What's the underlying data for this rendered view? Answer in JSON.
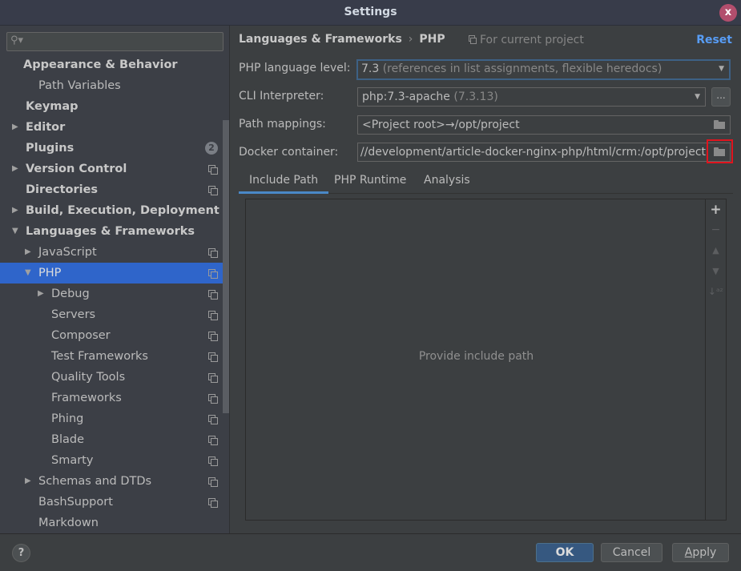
{
  "window": {
    "title": "Settings",
    "close_label": "x"
  },
  "sidebar": {
    "search_placeholder": "",
    "items": [
      {
        "label": "Appearance & Behavior",
        "bold": true,
        "level": 0,
        "arrow": "",
        "icon": ""
      },
      {
        "label": "Path Variables",
        "bold": false,
        "level": 1,
        "arrow": "",
        "icon": ""
      },
      {
        "label": "Keymap",
        "bold": true,
        "level": 0,
        "arrow": "",
        "icon": ""
      },
      {
        "label": "Editor",
        "bold": true,
        "level": 0,
        "arrow": "collapsed",
        "icon": ""
      },
      {
        "label": "Plugins",
        "bold": true,
        "level": 0,
        "arrow": "",
        "icon": "",
        "badge": "2"
      },
      {
        "label": "Version Control",
        "bold": true,
        "level": 0,
        "arrow": "collapsed",
        "icon": "project"
      },
      {
        "label": "Directories",
        "bold": true,
        "level": 0,
        "arrow": "",
        "icon": "project"
      },
      {
        "label": "Build, Execution, Deployment",
        "bold": true,
        "level": 0,
        "arrow": "collapsed",
        "icon": ""
      },
      {
        "label": "Languages & Frameworks",
        "bold": true,
        "level": 0,
        "arrow": "expanded",
        "icon": ""
      },
      {
        "label": "JavaScript",
        "bold": false,
        "level": 1,
        "arrow": "collapsed",
        "icon": "project"
      },
      {
        "label": "PHP",
        "bold": false,
        "level": 1,
        "arrow": "expanded",
        "icon": "project",
        "selected": true
      },
      {
        "label": "Debug",
        "bold": false,
        "level": 2,
        "arrow": "collapsed",
        "icon": "project"
      },
      {
        "label": "Servers",
        "bold": false,
        "level": 2,
        "arrow": "",
        "icon": "project"
      },
      {
        "label": "Composer",
        "bold": false,
        "level": 2,
        "arrow": "",
        "icon": "project"
      },
      {
        "label": "Test Frameworks",
        "bold": false,
        "level": 2,
        "arrow": "",
        "icon": "project"
      },
      {
        "label": "Quality Tools",
        "bold": false,
        "level": 2,
        "arrow": "",
        "icon": "project"
      },
      {
        "label": "Frameworks",
        "bold": false,
        "level": 2,
        "arrow": "",
        "icon": "project"
      },
      {
        "label": "Phing",
        "bold": false,
        "level": 2,
        "arrow": "",
        "icon": "project"
      },
      {
        "label": "Blade",
        "bold": false,
        "level": 2,
        "arrow": "",
        "icon": "project"
      },
      {
        "label": "Smarty",
        "bold": false,
        "level": 2,
        "arrow": "",
        "icon": "project"
      },
      {
        "label": "Schemas and DTDs",
        "bold": false,
        "level": 1,
        "arrow": "collapsed",
        "icon": "project"
      },
      {
        "label": "BashSupport",
        "bold": false,
        "level": 1,
        "arrow": "",
        "icon": "project"
      },
      {
        "label": "Markdown",
        "bold": false,
        "level": 1,
        "arrow": "",
        "icon": ""
      }
    ]
  },
  "header": {
    "breadcrumb": [
      "Languages & Frameworks",
      "PHP"
    ],
    "breadcrumb_sep": "›",
    "scope": "For current project",
    "reset": "Reset"
  },
  "form": {
    "language_level": {
      "label": "PHP language level:",
      "value": "7.3",
      "hint": "(references in list assignments, flexible heredocs)"
    },
    "cli_interpreter": {
      "label": "CLI Interpreter:",
      "value": "php:7.3-apache",
      "hint": "(7.3.13)",
      "more_button": "..."
    },
    "path_mappings": {
      "label": "Path mappings:",
      "value": "<Project root>→/opt/project"
    },
    "docker_container": {
      "label": "Docker container:",
      "value": "//development/article-docker-nginx-php/html/crm:/opt/project"
    }
  },
  "tabs": [
    {
      "label": "Include Path",
      "active": true
    },
    {
      "label": "PHP Runtime",
      "active": false
    },
    {
      "label": "Analysis",
      "active": false
    }
  ],
  "include_path": {
    "empty_text": "Provide include path",
    "tools": {
      "add": "+",
      "remove": "−",
      "up": "▲",
      "down": "▼",
      "sort": "↓ᵃᶻ"
    }
  },
  "footer": {
    "help": "?",
    "ok": "OK",
    "cancel": "Cancel",
    "apply_underline": "A",
    "apply_rest": "pply"
  },
  "colors": {
    "accent": "#589df6",
    "selection": "#2f65ca",
    "primary_button": "#365880",
    "close_button": "#b24e6d",
    "highlight_box": "#e0141e"
  }
}
